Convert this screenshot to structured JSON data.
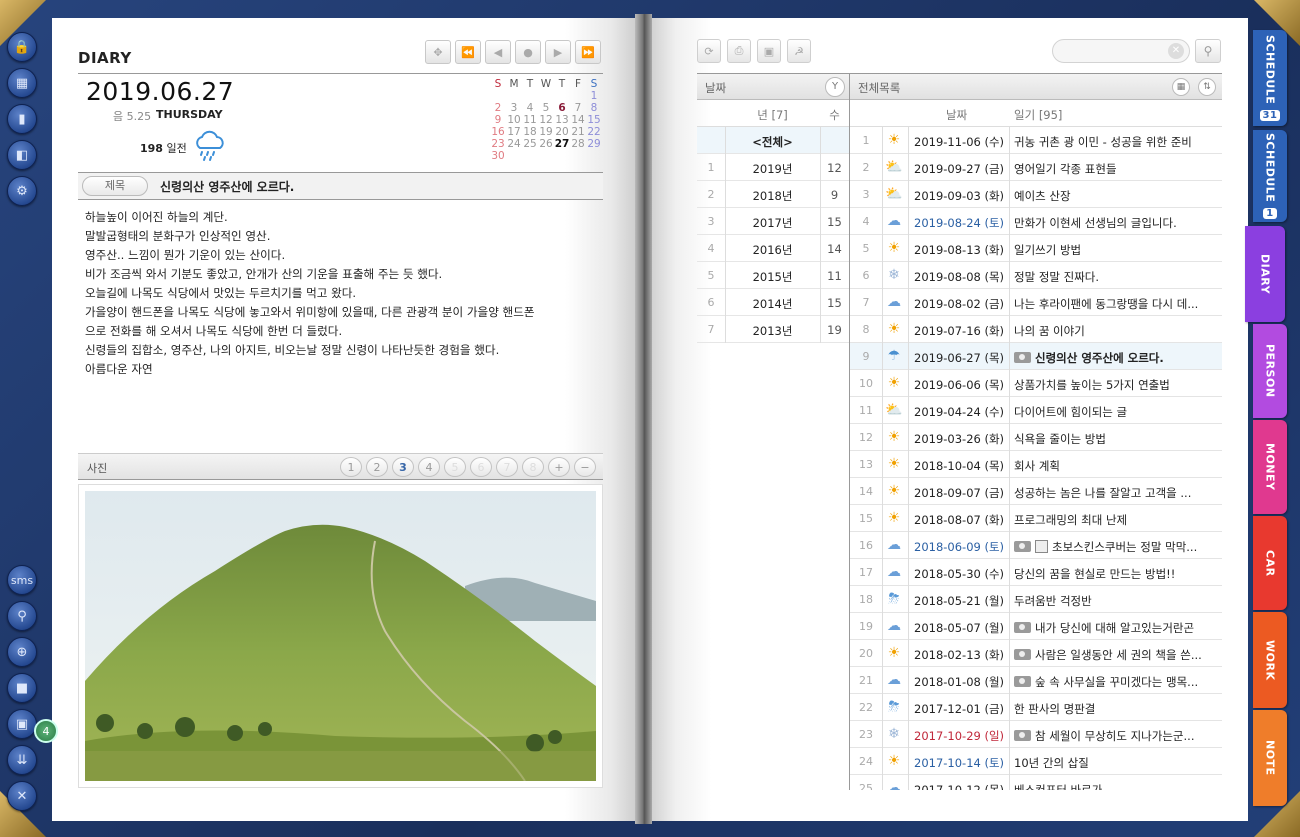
{
  "diary": {
    "title": "DIARY",
    "date": "2019.06.27",
    "lunar": "음 5.25",
    "weekday": "THURSDAY",
    "dday_num": "198",
    "dday_label": "일전",
    "title_label": "제목",
    "entry_title": "신령의산 영주산에 오르다.",
    "body_lines": [
      "하늘높이 이어진 하늘의 계단.",
      "말발굽형태의 분화구가 인상적인 영산.",
      "영주산.. 느낌이 뭔가 기운이 있는 산이다.",
      "비가 조금씩 와서 기분도 좋았고, 안개가 산의 기운을 표출해 주는 듯 했다.",
      "오늘길에 나목도 식당에서 맛있는 두르치기를 먹고 왔다.",
      "가을양이 핸드폰을 나목도 식당에 놓고와서 위미항에 있을때, 다른 관광객 분이 가을양 핸드폰",
      "으로 전화를 해 오셔서 나목도 식당에 한번 더 들렀다.",
      "신령들의 집합소, 영주산, 나의 아지트, 비오는날 정말 신령이 나타난듯한 경험을 했다.",
      "아름다운 자연"
    ],
    "photo_label": "사진",
    "photo_pages": [
      "1",
      "2",
      "3",
      "4",
      "5",
      "6",
      "7",
      "8"
    ],
    "photo_active": "3",
    "photo_count": "4"
  },
  "mini_calendar": {
    "headers": [
      "S",
      "M",
      "T",
      "W",
      "T",
      "F",
      "S"
    ],
    "weeks": [
      [
        "",
        "",
        "",
        "",
        "",
        "",
        "1"
      ],
      [
        "2",
        "3",
        "4",
        "5",
        "6",
        "7",
        "8"
      ],
      [
        "9",
        "10",
        "11",
        "12",
        "13",
        "14",
        "15"
      ],
      [
        "16",
        "17",
        "18",
        "19",
        "20",
        "21",
        "22"
      ],
      [
        "23",
        "24",
        "25",
        "26",
        "27",
        "28",
        "29"
      ],
      [
        "30",
        "",
        "",
        "",
        "",
        "",
        ""
      ]
    ],
    "today": "27",
    "marked": "6"
  },
  "left_toolbar": {
    "sms_label": "sms"
  },
  "list": {
    "year_header": "날짜",
    "year_btn": "Y",
    "year_col": "년 [7]",
    "count_col": "수",
    "all_label": "<전체>",
    "years": [
      {
        "n": "1",
        "year": "2019년",
        "count": "12"
      },
      {
        "n": "2",
        "year": "2018년",
        "count": "9"
      },
      {
        "n": "3",
        "year": "2017년",
        "count": "15"
      },
      {
        "n": "4",
        "year": "2016년",
        "count": "14"
      },
      {
        "n": "5",
        "year": "2015년",
        "count": "11"
      },
      {
        "n": "6",
        "year": "2014년",
        "count": "15"
      },
      {
        "n": "7",
        "year": "2013년",
        "count": "19"
      }
    ],
    "list_header": "전체목록",
    "date_col": "날짜",
    "diary_col": "일기 [95]",
    "entries": [
      {
        "n": "1",
        "w": "sun",
        "date": "2019-11-06 (수)",
        "title": "귀농 귀촌 광 이민 - 성공을 위한 준비",
        "cls": "",
        "cam": false,
        "disk": false
      },
      {
        "n": "2",
        "w": "partly",
        "date": "2019-09-27 (금)",
        "title": "영어일기 각종 표현들",
        "cls": "",
        "cam": false,
        "disk": false
      },
      {
        "n": "3",
        "w": "partly",
        "date": "2019-09-03 (화)",
        "title": "예이츠 산장",
        "cls": "",
        "cam": false,
        "disk": false
      },
      {
        "n": "4",
        "w": "cloud",
        "date": "2019-08-24 (토)",
        "title": "만화가 이현세 선생님의 글입니다.",
        "cls": "blue",
        "cam": false,
        "disk": false
      },
      {
        "n": "5",
        "w": "sun",
        "date": "2019-08-13 (화)",
        "title": "일기쓰기 방법",
        "cls": "",
        "cam": false,
        "disk": false
      },
      {
        "n": "6",
        "w": "snow",
        "date": "2019-08-08 (목)",
        "title": "정말 정말 진짜다.",
        "cls": "",
        "cam": false,
        "disk": false
      },
      {
        "n": "7",
        "w": "cloud",
        "date": "2019-08-02 (금)",
        "title": "나는 후라이팬에 동그랑땡을 다시 데...",
        "cls": "",
        "cam": false,
        "disk": false
      },
      {
        "n": "8",
        "w": "sun",
        "date": "2019-07-16 (화)",
        "title": "나의 꿈 이야기",
        "cls": "",
        "cam": false,
        "disk": false
      },
      {
        "n": "9",
        "w": "rain",
        "date": "2019-06-27 (목)",
        "title": "신령의산 영주산에 오르다.",
        "cls": "",
        "cam": true,
        "disk": false,
        "sel": true
      },
      {
        "n": "10",
        "w": "sun",
        "date": "2019-06-06 (목)",
        "title": "상품가치를 높이는 5가지 연출법",
        "cls": "",
        "cam": false,
        "disk": false
      },
      {
        "n": "11",
        "w": "partly",
        "date": "2019-04-24 (수)",
        "title": "다이어트에 힘이되는 글",
        "cls": "",
        "cam": false,
        "disk": false
      },
      {
        "n": "12",
        "w": "sun",
        "date": "2019-03-26 (화)",
        "title": "식욕을 줄이는 방법",
        "cls": "",
        "cam": false,
        "disk": false
      },
      {
        "n": "13",
        "w": "sun",
        "date": "2018-10-04 (목)",
        "title": "회사 계획",
        "cls": "",
        "cam": false,
        "disk": false
      },
      {
        "n": "14",
        "w": "sun",
        "date": "2018-09-07 (금)",
        "title": "성공하는 놈은 나를 잘알고 고객을 ...",
        "cls": "",
        "cam": false,
        "disk": false
      },
      {
        "n": "15",
        "w": "sun",
        "date": "2018-08-07 (화)",
        "title": "프로그래밍의 최대 난제",
        "cls": "",
        "cam": false,
        "disk": false
      },
      {
        "n": "16",
        "w": "cloud",
        "date": "2018-06-09 (토)",
        "title": "초보스킨스쿠버는 정말 막막...",
        "cls": "blue",
        "cam": true,
        "disk": true
      },
      {
        "n": "17",
        "w": "cloud",
        "date": "2018-05-30 (수)",
        "title": "당신의 꿈을 현실로 만드는 방법!!",
        "cls": "",
        "cam": false,
        "disk": false
      },
      {
        "n": "18",
        "w": "storm",
        "date": "2018-05-21 (월)",
        "title": "두려움반 걱정반",
        "cls": "",
        "cam": false,
        "disk": false
      },
      {
        "n": "19",
        "w": "cloud",
        "date": "2018-05-07 (월)",
        "title": "내가 당신에 대해 알고있는거란곤",
        "cls": "",
        "cam": true,
        "disk": false
      },
      {
        "n": "20",
        "w": "sun",
        "date": "2018-02-13 (화)",
        "title": "사람은 일생동안 세 권의 책을 쓴...",
        "cls": "",
        "cam": true,
        "disk": false
      },
      {
        "n": "21",
        "w": "cloud",
        "date": "2018-01-08 (월)",
        "title": "숲 속 사무실을 꾸미겠다는 맹목...",
        "cls": "",
        "cam": true,
        "disk": false
      },
      {
        "n": "22",
        "w": "storm",
        "date": "2017-12-01 (금)",
        "title": "한 판사의 명판결",
        "cls": "",
        "cam": false,
        "disk": false
      },
      {
        "n": "23",
        "w": "snow",
        "date": "2017-10-29 (일)",
        "title": "참 세월이 무상히도 지나가는군...",
        "cls": "red",
        "cam": true,
        "disk": false
      },
      {
        "n": "24",
        "w": "sun",
        "date": "2017-10-14 (토)",
        "title": "10년 간의 삽질",
        "cls": "blue",
        "cam": false,
        "disk": false
      },
      {
        "n": "25",
        "w": "cloud",
        "date": "2017-10-12 (목)",
        "title": "베스컨포터 바로가",
        "cls": "",
        "cam": false,
        "disk": false
      }
    ]
  },
  "tabs": [
    {
      "label": "SCHEDULE",
      "num": "31",
      "color": "#2d62b7"
    },
    {
      "label": "SCHEDULE",
      "num": "1",
      "color": "#2d62b7"
    },
    {
      "label": "DIARY",
      "num": "",
      "color": "#8b3fe0"
    },
    {
      "label": "PERSON",
      "num": "",
      "color": "#b24be0"
    },
    {
      "label": "MONEY",
      "num": "",
      "color": "#e0398f"
    },
    {
      "label": "CAR",
      "num": "",
      "color": "#e8392f"
    },
    {
      "label": "WORK",
      "num": "",
      "color": "#ec5a22"
    },
    {
      "label": "NOTE",
      "num": "",
      "color": "#ef7d2a"
    }
  ]
}
